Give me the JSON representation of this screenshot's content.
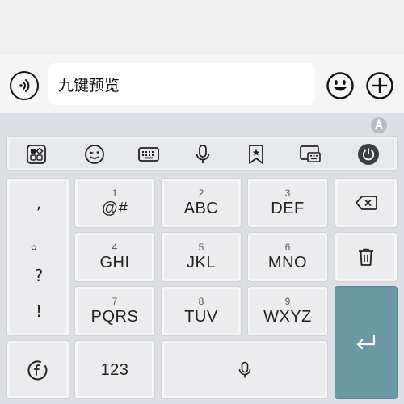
{
  "input": {
    "text": "九键预览"
  },
  "punctuation": [
    ",",
    "。",
    "?",
    "!"
  ],
  "keys": [
    {
      "num": "1",
      "label": "@#"
    },
    {
      "num": "2",
      "label": "ABC"
    },
    {
      "num": "3",
      "label": "DEF"
    },
    {
      "num": "4",
      "label": "GHI"
    },
    {
      "num": "5",
      "label": "JKL"
    },
    {
      "num": "6",
      "label": "MNO"
    },
    {
      "num": "7",
      "label": "PQRS"
    },
    {
      "num": "8",
      "label": "TUV"
    },
    {
      "num": "9",
      "label": "WXYZ"
    }
  ],
  "bottom": {
    "num_label": "123"
  },
  "icons": {
    "voice": "voice-input-icon",
    "emoji": "emoji-icon",
    "plus": "plus-icon",
    "toolbar": [
      "apps-icon",
      "wink-emoji-icon",
      "keyboard-icon",
      "microphone-icon",
      "bookmark-star-icon",
      "keyboard-switch-icon",
      "power-icon"
    ]
  },
  "colors": {
    "enter_key": "#6a99a4",
    "keyboard_bg": "#dcdfe3"
  }
}
